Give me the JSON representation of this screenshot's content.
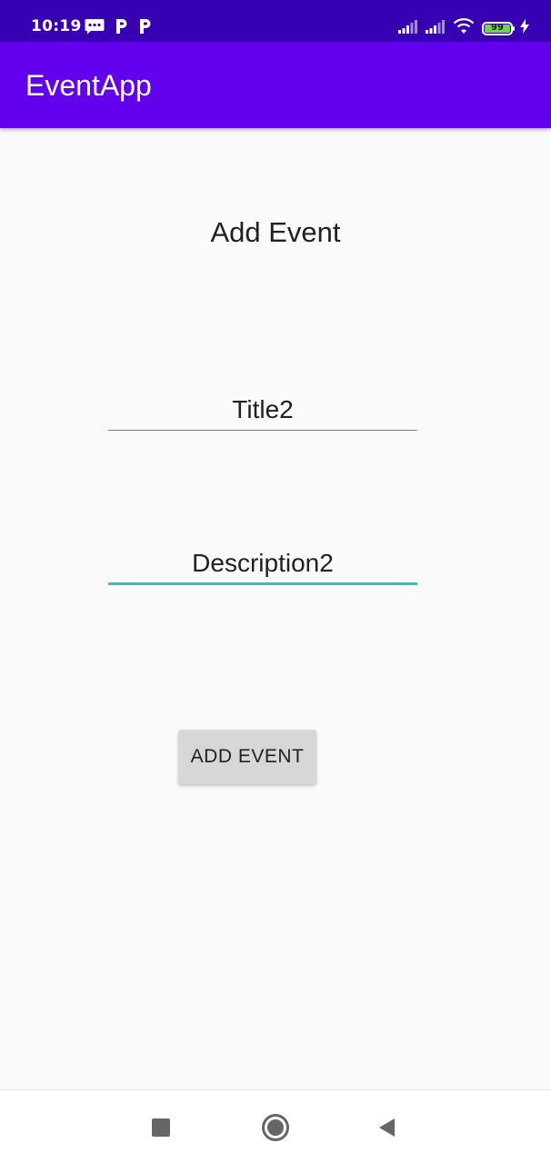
{
  "status_bar": {
    "time": "10:19",
    "battery_level": "99",
    "icons": [
      "sms-icon",
      "p-icon",
      "p-icon",
      "signal-icon",
      "signal-icon",
      "wifi-icon",
      "battery-icon",
      "charging-icon"
    ],
    "battery_color": "#6fd44c"
  },
  "app_bar": {
    "title": "EventApp",
    "color": "#6200ee"
  },
  "form": {
    "heading": "Add Event",
    "title_value": "Title2",
    "description_value": "Description2",
    "submit_label": "ADD EVENT",
    "focus_color": "#26c6b8"
  },
  "nav_bar": {
    "icons": [
      "recents-icon",
      "home-icon",
      "back-icon"
    ]
  }
}
